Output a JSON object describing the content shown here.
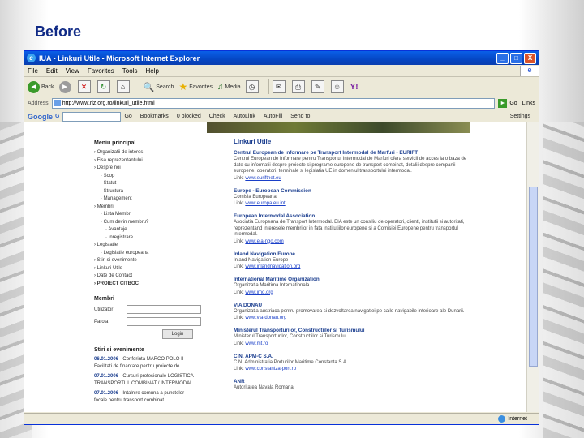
{
  "slide": {
    "title": "Before"
  },
  "browser": {
    "title": "IUA - Linkuri Utile - Microsoft Internet Explorer",
    "window_buttons": {
      "minimize": "_",
      "maximize": "□",
      "close": "X"
    },
    "throbber": "e",
    "menu": [
      "File",
      "Edit",
      "View",
      "Favorites",
      "Tools",
      "Help"
    ],
    "toolbar": {
      "back": "Back",
      "search": "Search",
      "favorites": "Favorites",
      "media": "Media"
    },
    "address": {
      "label": "Address",
      "url": "http://www.riz.org.ro/linkuri_utile.html",
      "go": "Go",
      "links": "Links"
    },
    "google_bar": {
      "logo": "Google",
      "g_label": "G",
      "items": [
        "Go",
        "Bookmarks",
        "0 blocked",
        "Check",
        "AutoLink",
        "AutoFill",
        "Send to",
        "Settings"
      ]
    },
    "status": {
      "zone": "Internet"
    }
  },
  "page": {
    "main_menu_title": "Meniu principal",
    "menu_items": [
      {
        "label": "Organizatii de interes",
        "level": 0
      },
      {
        "label": "Fisa reprezentantului",
        "level": 0
      },
      {
        "label": "Despre noi",
        "level": 0
      },
      {
        "label": "Scop",
        "level": 1
      },
      {
        "label": "Statut",
        "level": 1
      },
      {
        "label": "Structura",
        "level": 1
      },
      {
        "label": "Management",
        "level": 1
      },
      {
        "label": "Membri",
        "level": 0
      },
      {
        "label": "Lista Membri",
        "level": 1
      },
      {
        "label": "Cum devin membru?",
        "level": 1
      },
      {
        "label": "Avantaje",
        "level": 2
      },
      {
        "label": "Inregistrare",
        "level": 2
      },
      {
        "label": "Legislatie",
        "level": 0
      },
      {
        "label": "Legislatie europeana",
        "level": 1
      },
      {
        "label": "Stiri si evenimente",
        "level": 0
      },
      {
        "label": "Linkuri Utile",
        "level": 0
      },
      {
        "label": "Date de Contact",
        "level": 0
      },
      {
        "label": "PROIECT CITBOC",
        "level": 0,
        "bold": true
      }
    ],
    "members_title": "Membri",
    "login": {
      "user_label": "Utilizator",
      "pass_label": "Parola",
      "button": "Login"
    },
    "news_title": "Stiri si evenimente",
    "news": [
      {
        "date": "06.01.2006",
        "text": "Conferinta MARCO POLO II",
        "extra": "Facilitati de finantare pentru proiecte de..."
      },
      {
        "date": "07.01.2006",
        "text": "Cursuri profesionale LOGISTICA",
        "extra": "TRANSPORTUL COMBINAT / INTERMODAL"
      },
      {
        "date": "07.01.2006",
        "text": "Intalnire comuna a punctelor",
        "extra": "focale pentru transport combinat..."
      }
    ],
    "heading": "Linkuri Utile",
    "links": [
      {
        "title": "Centrul European de Informare pe Transport Intermodal de Marfuri - EURIFT",
        "desc": "Centrul European de Informare pentru Transportul Intermodal de Marfuri ofera servicii de acces la o baza de date cu informatii despre proiecte si programe europene de transport combinat, detalii despre companii europene, operatori, terminale si legislatia UE in domeniul transportului intermodal.",
        "url": "www.euriftnet.eu"
      },
      {
        "title": "Europe - European Commission",
        "desc": "Comisia Europeana",
        "url": "www.europa.eu.int"
      },
      {
        "title": "European Intermodal Association",
        "desc": "Asociatia Europeana de Transport Intermodal. EIA este un consiliu de operatori, clienti, institutii si autoritati, reprezentand interesele membrilor in fata institutiilor europene si a Comisiei Europene pentru transportul intermodal.",
        "url": "www.eia-ngo.com"
      },
      {
        "title": "Inland Navigation Europe",
        "desc": "Inland Navigation Europe",
        "url": "www.inlandnavigation.org"
      },
      {
        "title": "International Maritime Organization",
        "desc": "Organizatia Maritima Internationala",
        "url": "www.imo.org"
      },
      {
        "title": "VIA DONAU",
        "desc": "Organizatia austriaca pentru promovarea si dezvoltarea navigatiei pe caile navigabile interioare ale Dunarii.",
        "url": "www.via-donau.org"
      },
      {
        "title": "Ministerul Transporturilor, Constructiilor si Turismului",
        "desc": "Ministerul Transporturilor, Constructiilor si Turismului",
        "url": "www.mt.ro"
      },
      {
        "title": "C.N. APM-C S.A.",
        "desc": "C.N. Administratia Porturilor Maritime Constanta S.A.",
        "url": "www.constantza-port.ro"
      },
      {
        "title": "ANR",
        "desc": "Autoritatea Navala Romana",
        "url": ""
      }
    ]
  },
  "colors": {
    "title": "#102a86",
    "link_heading": "#1b3e8f",
    "link": "#1a3fc8",
    "titlebar": "#0546c4"
  }
}
